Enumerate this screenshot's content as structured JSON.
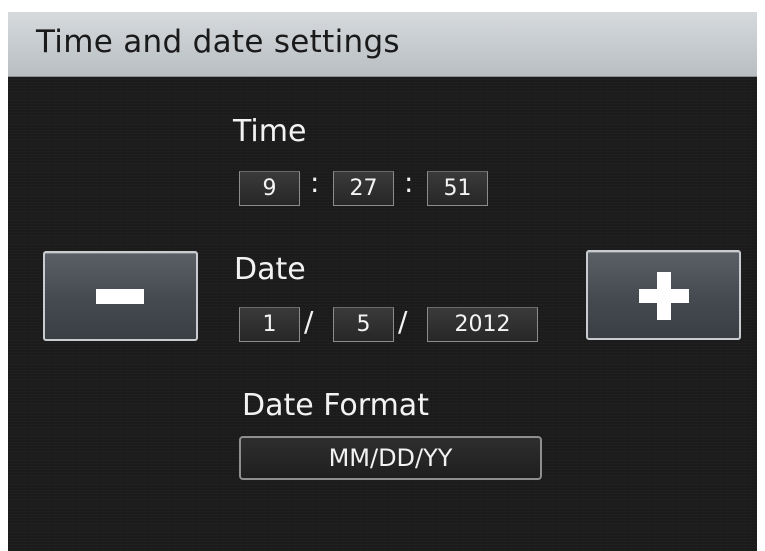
{
  "header": {
    "title": "Time and date settings"
  },
  "time": {
    "label": "Time",
    "hours": "9",
    "minutes": "27",
    "seconds": "51",
    "separator": ":"
  },
  "date": {
    "label": "Date",
    "month": "1",
    "day": "5",
    "year": "2012",
    "separator": "/"
  },
  "date_format": {
    "label": "Date Format",
    "value": "MM/DD/YY"
  },
  "buttons": {
    "decrement_icon": "minus-icon",
    "increment_icon": "plus-icon"
  },
  "colors": {
    "titlebar": "#c8ccd0",
    "background": "#1c1c1c",
    "text": "#f2f2f2"
  }
}
